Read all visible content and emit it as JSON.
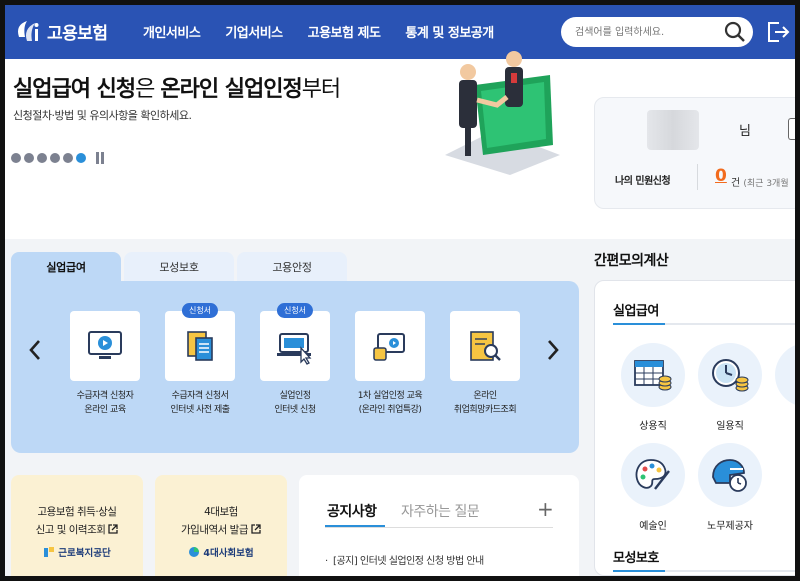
{
  "header": {
    "logo_text": "고용보험",
    "nav": [
      "개인서비스",
      "기업서비스",
      "고용보험 제도",
      "통계 및 정보공개"
    ],
    "search_placeholder": "검색어를 입력하세요."
  },
  "hero": {
    "title_bold1": "실업급여 신청",
    "title_light1": "은 ",
    "title_bold2": "온라인 실업인정",
    "title_light2": "부터",
    "subtitle": "신청절차·방법 및 유의사항을 확인하세요."
  },
  "user_card": {
    "suffix": "님",
    "label": "나의 민원신청",
    "count": "0",
    "unit": "건",
    "note": "(최근 3개월"
  },
  "tabs": [
    "실업급여",
    "모성보호",
    "고용안정"
  ],
  "services": [
    {
      "label": "수급자격 신청자\n온라인 교육",
      "badge": ""
    },
    {
      "label": "수급자격 신청서\n인터넷 사전 제출",
      "badge": "신청서"
    },
    {
      "label": "실업인정\n인터넷 신청",
      "badge": "신청서"
    },
    {
      "label": "1차 실업인정 교육\n(온라인 취업특강)",
      "badge": ""
    },
    {
      "label": "온라인\n취업희망카드조회",
      "badge": ""
    }
  ],
  "calculator": {
    "title": "간편모의계산",
    "section1": "실업급여",
    "items": [
      "상용직",
      "일용직",
      "예술인",
      "노무제공자"
    ],
    "section2": "모성보호"
  },
  "bottom": {
    "box1_text": "고용보험 취득·상실\n신고 및 이력조회",
    "box1_org": "근로복지공단",
    "box2_text": "4대보험\n가입내역서 발급",
    "box2_org": "4대사회보험"
  },
  "notice": {
    "tab1": "공지사항",
    "tab2": "자주하는 질문",
    "plus": "+",
    "item1": "[공지] 인터넷 실업인정 신청 방법 안내"
  },
  "colors": {
    "header": "#2a53b4",
    "accent": "#2a8fd9",
    "panel": "#bdd8f6",
    "orange": "#f26b1d"
  }
}
